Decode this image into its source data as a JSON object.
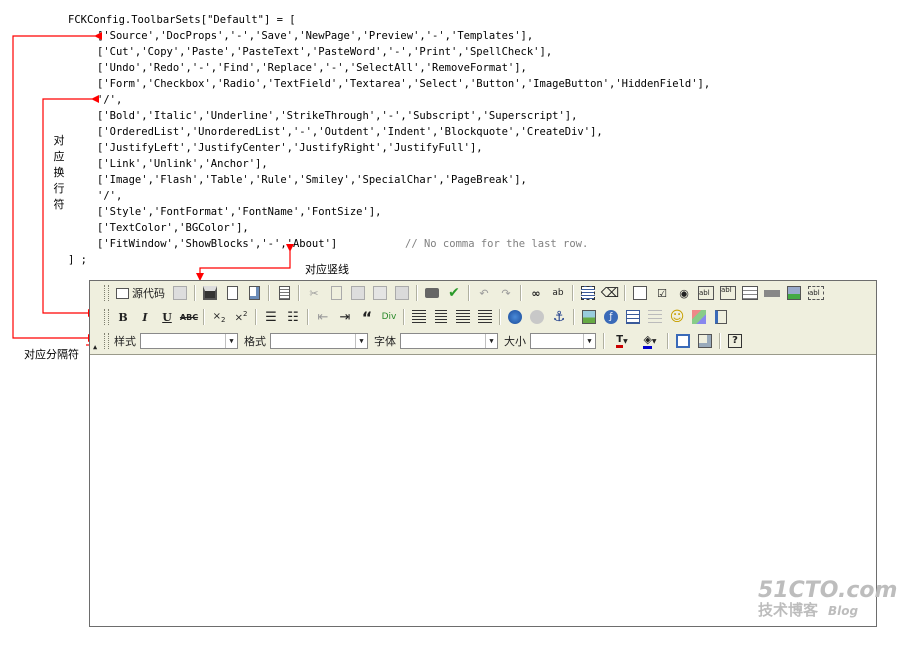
{
  "code": {
    "lines": [
      "FCKConfig.ToolbarSets[\"Default\"] = [",
      "['Source','DocProps','-','Save','NewPage','Preview','-','Templates'],",
      "['Cut','Copy','Paste','PasteText','PasteWord','-','Print','SpellCheck'],",
      "['Undo','Redo','-','Find','Replace','-','SelectAll','RemoveFormat'],",
      "['Form','Checkbox','Radio','TextField','Textarea','Select','Button','ImageButton','HiddenField'],",
      "'/',",
      "['Bold','Italic','Underline','StrikeThrough','-','Subscript','Superscript'],",
      "['OrderedList','UnorderedList','-','Outdent','Indent','Blockquote','CreateDiv'],",
      "['JustifyLeft','JustifyCenter','JustifyRight','JustifyFull'],",
      "['Link','Unlink','Anchor'],",
      "['Image','Flash','Table','Rule','Smiley','SpecialChar','PageBreak'],",
      "'/',",
      "['Style','FontFormat','FontName','FontSize'],",
      "['TextColor','BGColor'],",
      "['FitWindow','ShowBlocks','-','About']"
    ],
    "comment": "// No comma for the last row.",
    "closing": "] ;"
  },
  "annotations": {
    "newline_chars": [
      "对",
      "应",
      "换",
      "行",
      "符"
    ],
    "separator_label": "对应分隔符",
    "vertical_bar_label": "对应竖线"
  },
  "toolbar": {
    "source_label": "源代码",
    "style_label": "样式",
    "format_label": "格式",
    "font_label": "字体",
    "size_label": "大小",
    "style_value": "",
    "format_value": "",
    "font_value": "",
    "size_value": ""
  },
  "watermark": {
    "brand": "51CTO.com",
    "tagline": "技术博客",
    "blog": "Blog"
  },
  "colors": {
    "arrow": "#ff0000",
    "toolbar_bg": "#efefde",
    "comment": "#808080"
  }
}
